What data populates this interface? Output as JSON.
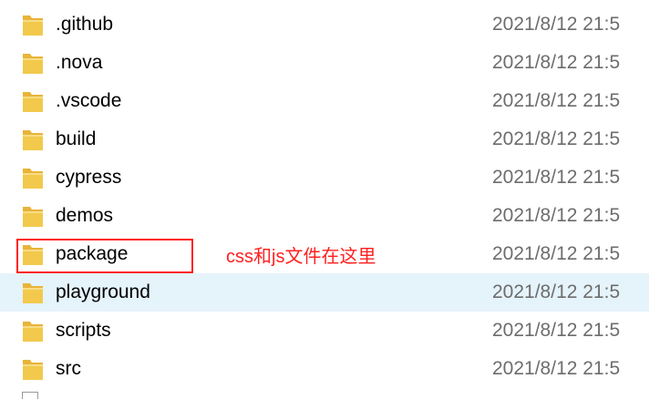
{
  "files": [
    {
      "name": ".github",
      "date": "2021/8/12 21:5"
    },
    {
      "name": ".nova",
      "date": "2021/8/12 21:5"
    },
    {
      "name": ".vscode",
      "date": "2021/8/12 21:5"
    },
    {
      "name": "build",
      "date": "2021/8/12 21:5"
    },
    {
      "name": "cypress",
      "date": "2021/8/12 21:5"
    },
    {
      "name": "demos",
      "date": "2021/8/12 21:5"
    },
    {
      "name": "package",
      "date": "2021/8/12 21:5"
    },
    {
      "name": "playground",
      "date": "2021/8/12 21:5"
    },
    {
      "name": "scripts",
      "date": "2021/8/12 21:5"
    },
    {
      "name": "src",
      "date": "2021/8/12 21:5"
    }
  ],
  "annotation": {
    "text": "css和js文件在这里",
    "color": "#ff2020"
  },
  "colors": {
    "folder_body": "#f2c94c",
    "folder_back": "#e8b43a",
    "hover_row": "#e5f3fb",
    "date_text": "#6d6d6d"
  },
  "icons": {
    "folder": "folder-icon",
    "file": "file-icon"
  }
}
